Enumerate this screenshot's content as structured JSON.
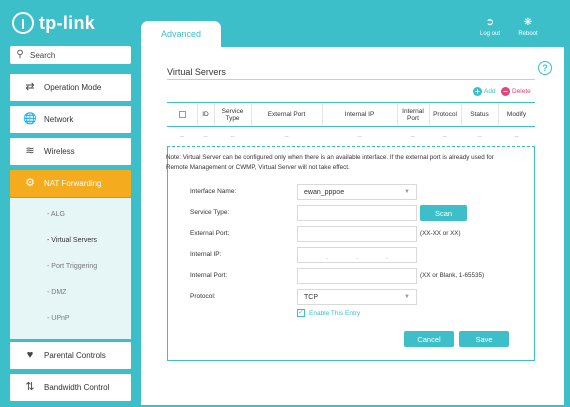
{
  "logo": {
    "text": "tp-link"
  },
  "search": {
    "placeholder": "Search"
  },
  "sidebar": {
    "items": [
      {
        "label": "Operation Mode",
        "icon": "operation-mode-icon"
      },
      {
        "label": "Network",
        "icon": "globe-icon"
      },
      {
        "label": "Wireless",
        "icon": "wireless-icon"
      },
      {
        "label": "NAT Forwarding",
        "icon": "gear-icon"
      },
      {
        "label": "Parental Controls",
        "icon": "heart-icon"
      },
      {
        "label": "Bandwidth Control",
        "icon": "arrows-icon"
      }
    ],
    "submenu": [
      "- ALG",
      "- Virtual Servers",
      "- Port Triggering",
      "- DMZ",
      "- UPnP"
    ],
    "active_color": "#f5ab1e"
  },
  "header": {
    "tab": "Advanced",
    "logout": "Log out",
    "reboot": "Reboot",
    "accent_color": "#3cbfc8"
  },
  "main": {
    "title": "Virtual Servers",
    "add": "Add",
    "delete": "Delete",
    "columns": [
      "ID",
      "Service Type",
      "External Port",
      "Internal IP",
      "Internal Port",
      "Protocol",
      "Status",
      "Modify"
    ],
    "empty_row": [
      "--",
      "--",
      "--",
      "--",
      "--",
      "--",
      "--",
      "--",
      "--"
    ],
    "note": "Note: Virtual Server can be configured only when there is an available interface. If the external port is already used for Remote Management or CWMP, Virtual Server will not take effect.",
    "form": {
      "interface_label": "Interface Name:",
      "interface_value": "ewan_pppoe",
      "service_label": "Service Type:",
      "service_value": "",
      "scan": "Scan",
      "external_label": "External Port:",
      "external_value": "",
      "external_hint": "(XX-XX or XX)",
      "internal_ip_label": "Internal IP:",
      "internal_port_label": "Internal Port:",
      "internal_port_value": "",
      "internal_port_hint": "(XX or Blank, 1-65535)",
      "protocol_label": "Protocol:",
      "protocol_value": "TCP",
      "enable_label": "Enable This Entry",
      "cancel": "Cancel",
      "save": "Save"
    }
  }
}
